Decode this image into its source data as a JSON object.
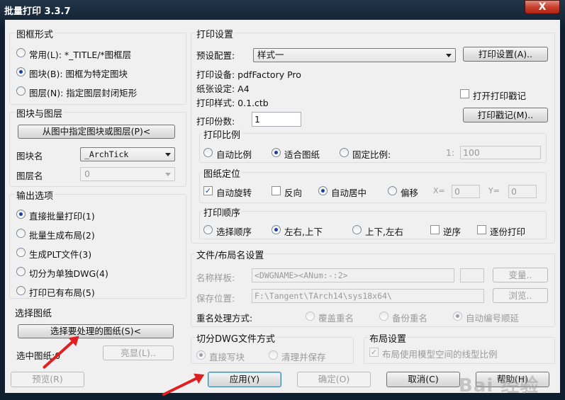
{
  "window": {
    "title": "批量打印 3.3.7",
    "close_label": "X"
  },
  "frame_form": {
    "title": "图框形式",
    "options": [
      {
        "label": "常用(L): *_TITLE/*图框层",
        "checked": false
      },
      {
        "label": "图块(B): 图框为特定图块",
        "checked": true
      },
      {
        "label": "图层(N): 指定图层封闭矩形",
        "checked": false
      }
    ]
  },
  "block_layer": {
    "title": "图块与图层",
    "pick_button": "从图中指定图块或图层(P)<",
    "block_label": "图块名",
    "block_value": "_ArchTick",
    "layer_label": "图层名",
    "layer_value": "0"
  },
  "output_options": {
    "title": "输出选项",
    "options": [
      {
        "label": "直接批量打印(1)",
        "checked": true
      },
      {
        "label": "批量生成布局(2)",
        "checked": false
      },
      {
        "label": "生成PLT文件(3)",
        "checked": false
      },
      {
        "label": "切分为单独DWG(4)",
        "checked": false
      },
      {
        "label": "打印已有布局(5)",
        "checked": false
      }
    ]
  },
  "select_drawings": {
    "title": "选择图纸",
    "select_button": "选择要处理的图纸(S)<",
    "selected_label": "选中图纸:0",
    "highlight_button": "亮显(L).."
  },
  "print_settings": {
    "title": "打印设置",
    "preset_label": "预设配置:",
    "preset_value": "样式一",
    "settings_button": "打印设置(A)..",
    "device_line": "打印设备: pdfFactory Pro",
    "paper_line": "纸张设定: A4",
    "style_line": "打印样式: 0.1.ctb",
    "stamp_checkbox": "打开打印戳记",
    "copies_label": "打印份数:",
    "copies_value": "1",
    "stamp_button": "打印戳记(M).."
  },
  "print_scale": {
    "title": "打印比例",
    "auto": "自动比例",
    "fit": "适合图纸",
    "fixed": "固定比例:",
    "ratio_prefix": "1:",
    "ratio_value": "100"
  },
  "frame_position": {
    "title": "图纸定位",
    "auto_rotate": "自动旋转",
    "reverse": "反向",
    "auto_center": "自动居中",
    "offset": "偏移",
    "x_label": "X=",
    "x_value": "0",
    "y_label": "Y=",
    "y_value": "0"
  },
  "print_order": {
    "title": "打印顺序",
    "select_order": "选择顺序",
    "lr_tb": "左右,上下",
    "tb_lr": "上下,左右",
    "reverse": "逆序",
    "one_by_one": "逐份打印"
  },
  "file_layout_name": {
    "title": "文件/布局名设置",
    "template_label": "名称样板:",
    "template_value": "<DWGNAME><ANum:-:2>",
    "vars_button": "变量..",
    "save_label": "保存位置:",
    "save_value": "F:\\Tangent\\TArch14\\sys18x64\\",
    "browse_button": "浏览..",
    "rename_label": "重名处理方式:",
    "overwrite": "覆盖重名",
    "backup": "备份重名",
    "auto_number": "自动编号顺延"
  },
  "split_dwg": {
    "title": "切分DWG文件方式",
    "write_block": "直接写块",
    "purge_save": "清理并保存"
  },
  "layout_settings": {
    "title": "布局设置",
    "model_linetype": "布局使用模型空间的线型比例"
  },
  "buttons": {
    "preview": "预览(R)",
    "apply": "应用(Y)",
    "ok": "确定(O)",
    "cancel": "取消(C)",
    "help": "帮助(H)"
  },
  "watermark": "Bai 经验",
  "colors": {
    "annotation_arrow": "#e02020",
    "default_button_border": "#3c7fb1"
  }
}
